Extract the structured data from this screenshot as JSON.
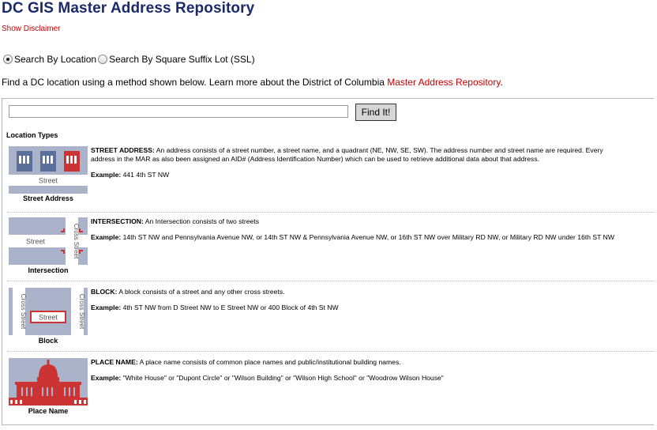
{
  "header": {
    "title": "DC GIS Master Address Repository",
    "disclaimer_link": "Show Disclaimer"
  },
  "search_mode": {
    "options": [
      {
        "label": "Search By Location",
        "selected": true
      },
      {
        "label": "Search By Square Suffix Lot (SSL)",
        "selected": false
      }
    ]
  },
  "intro": {
    "text": "Find a DC location using a method shown below.  Learn more about the District of Columbia ",
    "link": "Master Address Repository",
    "suffix": "."
  },
  "search": {
    "value": "",
    "placeholder": "",
    "button_label": "Find It!"
  },
  "location_types": {
    "heading": "Location Types",
    "items": [
      {
        "thumb_label": "Street Address",
        "icon": "street-address-icon",
        "title": "STREET ADDRESS:",
        "description": " An address consists of a street number, a street name, and a quadrant (NE, NW, SE, SW). The address number and street name are required. Every address in the MAR as also been assigned an AID# (Address Identification Number) which can be used to retrieve additional data about that address.",
        "example_label": "Example:",
        "example": " 441 4th ST NW"
      },
      {
        "thumb_label": "Intersection",
        "icon": "intersection-icon",
        "title": "INTERSECTION:",
        "description": " An Intersection consists of two streets",
        "example_label": "Example:",
        "example": " 14th ST NW and Pennsylvania Avenue NW, or 14th ST NW & Pennsylvania Avenue NW, or 16th ST NW over Military RD NW, or Military RD NW under 16th ST NW"
      },
      {
        "thumb_label": "Block",
        "icon": "block-icon",
        "title": "BLOCK:",
        "description": " A block consists of a street and any other cross streets.",
        "example_label": "Example:",
        "example": "  4th ST NW from D Street NW to E Street NW or 400 Block of 4th St NW"
      },
      {
        "thumb_label": "Place Name",
        "icon": "capitol-building-icon",
        "title": "PLACE NAME:",
        "description": " A place name consists of common place names and public/institutional building names.",
        "example_label": "Example:",
        "example": "  \"White House\" or \"Dupont Circle\" or \"Wilson Building\" or \"Wilson High School\" or \"Woodrow Wilson House\""
      }
    ]
  },
  "thumb_text": {
    "street": "Street",
    "cross_street": "Cross Street"
  },
  "colors": {
    "title": "#1b2a6b",
    "link": "#cc0000",
    "thumb_bg": "#aab3c9",
    "accent_red": "#cc3333",
    "building_blue": "#5b6f9c"
  }
}
